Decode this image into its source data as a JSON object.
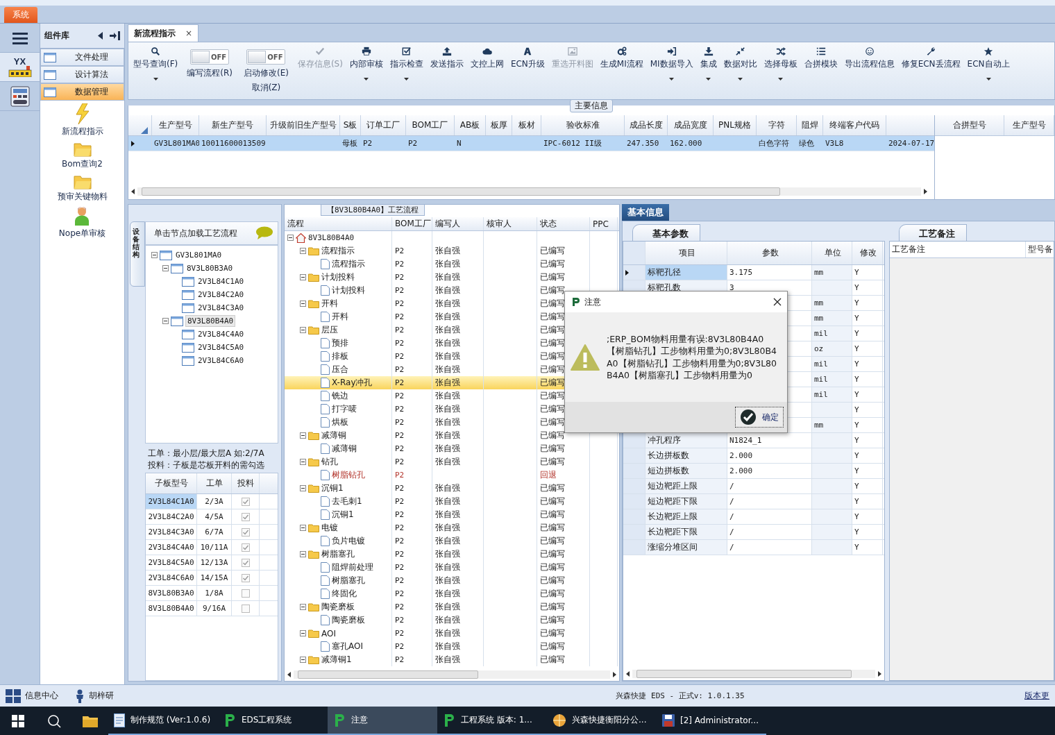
{
  "nav": {
    "logo_text": "YX"
  },
  "app_tab": {
    "label": "系统"
  },
  "component_library": {
    "title": "组件库",
    "items": [
      {
        "label": "文件处理",
        "selected": false
      },
      {
        "label": "设计算法",
        "selected": false
      },
      {
        "label": "数据管理",
        "selected": true
      }
    ],
    "tools": [
      {
        "label": "新流程指示",
        "kind": "lightning"
      },
      {
        "label": "Bom查询2",
        "kind": "folder"
      },
      {
        "label": "预审关键物料",
        "kind": "folder"
      },
      {
        "label": "Nope单审核",
        "kind": "person"
      }
    ]
  },
  "doc_tab": {
    "label": "新流程指示",
    "close": "×"
  },
  "toolbar": [
    {
      "kind": "search",
      "label": "型号查询(F)",
      "disabled": false,
      "dropdown": true
    },
    {
      "kind": "toggle",
      "label": "编写流程(R)",
      "text": "OFF",
      "on": false
    },
    {
      "kind": "toggle",
      "label": "启动修改(E)",
      "sublabel": "取消(Z)",
      "text": "OFF",
      "on": false
    },
    {
      "kind": "check",
      "label": "保存信息(S)",
      "disabled": true,
      "dropdown": false
    },
    {
      "kind": "printer",
      "label": "内部审核",
      "disabled": false,
      "dropdown": true
    },
    {
      "kind": "checkbox",
      "label": "指示检查",
      "disabled": false,
      "dropdown": true
    },
    {
      "kind": "upload",
      "label": "发送指示",
      "disabled": false,
      "dropdown": false
    },
    {
      "kind": "cloud",
      "label": "文控上网",
      "disabled": false,
      "dropdown": false
    },
    {
      "kind": "font",
      "label": "ECN升级",
      "disabled": false,
      "dropdown": false
    },
    {
      "kind": "image",
      "label": "重选开料图",
      "disabled": true,
      "dropdown": false
    },
    {
      "kind": "gears",
      "label": "生成MI流程",
      "disabled": false,
      "dropdown": false
    },
    {
      "kind": "sign-in",
      "label": "MI数据导入",
      "disabled": false,
      "dropdown": true
    },
    {
      "kind": "download",
      "label": "集成",
      "disabled": false,
      "dropdown": true
    },
    {
      "kind": "compress",
      "label": "数据对比",
      "disabled": false,
      "dropdown": true
    },
    {
      "kind": "shuffle",
      "label": "选择母板",
      "disabled": false,
      "dropdown": true
    },
    {
      "kind": "list",
      "label": "合拼模块",
      "disabled": false,
      "dropdown": false
    },
    {
      "kind": "smiley",
      "label": "导出流程信息",
      "disabled": false,
      "dropdown": false
    },
    {
      "kind": "wrench",
      "label": "修复ECN丢流程",
      "disabled": false,
      "dropdown": false
    },
    {
      "kind": "star",
      "label": "ECN自动上",
      "disabled": false,
      "dropdown": true
    }
  ],
  "main_info": {
    "title": "主要信息",
    "columns": [
      "生产型号",
      "新生产型号",
      "升级前旧生产型号",
      "S板",
      "订单工厂",
      "BOM工厂",
      "AB板",
      "板厚",
      "板材",
      "验收标准",
      "成品长度",
      "成品宽度",
      "PNL规格",
      "字符",
      "阻焊",
      "终端客户代码"
    ],
    "rows": [
      {
        "selected": true,
        "cells": [
          "GV3L801MA0",
          "10011600013509",
          null,
          "母板",
          "P2",
          "P2",
          "N",
          null,
          null,
          "IPC-6012 II级",
          "247.350",
          "162.000",
          null,
          "白色字符",
          "绿色",
          "V3L8",
          "2024-07-17"
        ]
      }
    ],
    "side_columns": [
      "合拼型号",
      "生产型号"
    ]
  },
  "structure_panel": {
    "side_tab": "设备结构",
    "title": "单击节点加载工艺流程",
    "tree": [
      {
        "label": "GV3L801MA0",
        "selected": false,
        "expanded": true,
        "children": [
          {
            "label": "8V3L80B3A0",
            "selected": false,
            "expanded": true,
            "children": [
              {
                "label": "2V3L84C1A0",
                "selected": false
              },
              {
                "label": "2V3L84C2A0",
                "selected": false
              },
              {
                "label": "2V3L84C3A0",
                "selected": false
              }
            ]
          },
          {
            "label": "8V3L80B4A0",
            "selected": true,
            "expanded": true,
            "children": [
              {
                "label": "2V3L84C4A0",
                "selected": false
              },
              {
                "label": "2V3L84C5A0",
                "selected": false
              },
              {
                "label": "2V3L84C6A0",
                "selected": false
              }
            ]
          }
        ]
      }
    ],
    "notes": [
      "工单：最小层/最大层A 如:2/7A",
      "投料：子板是芯板开料的需勾选"
    ],
    "board_table": {
      "columns": [
        "子板型号",
        "工单",
        "投料"
      ],
      "rows": [
        {
          "model": "2V3L84C1A0",
          "order": "2/3A",
          "checked": true,
          "selected": true
        },
        {
          "model": "2V3L84C2A0",
          "order": "4/5A",
          "checked": true,
          "selected": false
        },
        {
          "model": "2V3L84C3A0",
          "order": "6/7A",
          "checked": true,
          "selected": false
        },
        {
          "model": "2V3L84C4A0",
          "order": "10/11A",
          "checked": true,
          "selected": false
        },
        {
          "model": "2V3L84C5A0",
          "order": "12/13A",
          "checked": true,
          "selected": false
        },
        {
          "model": "2V3L84C6A0",
          "order": "14/15A",
          "checked": true,
          "selected": false
        },
        {
          "model": "8V3L80B3A0",
          "order": "1/8A",
          "checked": false,
          "selected": false
        },
        {
          "model": "8V3L80B4A0",
          "order": "9/16A",
          "checked": false,
          "selected": false
        }
      ]
    }
  },
  "process": {
    "title": "【8V3L80B4A0】工艺流程",
    "columns": [
      "流程",
      "BOM工厂",
      "编写人",
      "核审人",
      "状态",
      "PPC"
    ],
    "tree": [
      {
        "kind": "root",
        "label": "8V3L80B4A0",
        "selected": false,
        "expanded": true,
        "children": [
          {
            "kind": "group",
            "label": "流程指示",
            "factory": "P2",
            "writer": "张自强",
            "status": "已编写",
            "selected": false,
            "expanded": true,
            "children": [
              {
                "kind": "step",
                "label": "流程指示",
                "factory": "P2",
                "writer": "张自强",
                "status": "已编写",
                "selected": false
              }
            ]
          },
          {
            "kind": "group",
            "label": "计划投料",
            "factory": "P2",
            "writer": "张自强",
            "status": "已编写",
            "selected": false,
            "expanded": true,
            "children": [
              {
                "kind": "step",
                "label": "计划投料",
                "factory": "P2",
                "writer": "张自强",
                "status": "已编写",
                "selected": false
              }
            ]
          },
          {
            "kind": "group",
            "label": "开料",
            "factory": "P2",
            "writer": "张自强",
            "status": "已编写",
            "selected": false,
            "expanded": true,
            "children": [
              {
                "kind": "step",
                "label": "开料",
                "factory": "P2",
                "writer": "张自强",
                "status": "已编写",
                "selected": false
              }
            ]
          },
          {
            "kind": "group",
            "label": "层压",
            "factory": "P2",
            "writer": "张自强",
            "status": "已编写",
            "selected": false,
            "expanded": true,
            "children": [
              {
                "kind": "step",
                "label": "预排",
                "factory": "P2",
                "writer": "张自强",
                "status": "已编写",
                "selected": false
              },
              {
                "kind": "step",
                "label": "排板",
                "factory": "P2",
                "writer": "张自强",
                "status": "已编写",
                "selected": false
              },
              {
                "kind": "step",
                "label": "压合",
                "factory": "P2",
                "writer": "张自强",
                "status": "已编写",
                "selected": false
              },
              {
                "kind": "step",
                "label": "X-Ray冲孔",
                "factory": "P2",
                "writer": "张自强",
                "status": "已编写",
                "selected": true
              },
              {
                "kind": "step",
                "label": "铣边",
                "factory": "P2",
                "writer": "张自强",
                "status": "已编写",
                "selected": false
              },
              {
                "kind": "step",
                "label": "打字唛",
                "factory": "P2",
                "writer": "张自强",
                "status": "已编写",
                "selected": false
              },
              {
                "kind": "step",
                "label": "烘板",
                "factory": "P2",
                "writer": "张自强",
                "status": "已编写",
                "selected": false
              }
            ]
          },
          {
            "kind": "group",
            "label": "减薄铜",
            "factory": "P2",
            "writer": "张自强",
            "status": "已编写",
            "selected": false,
            "expanded": true,
            "children": [
              {
                "kind": "step",
                "label": "减薄铜",
                "factory": "P2",
                "writer": "张自强",
                "status": "已编写",
                "selected": false
              }
            ]
          },
          {
            "kind": "group",
            "label": "钻孔",
            "factory": "P2",
            "writer": "张自强",
            "status": "已编写",
            "selected": false,
            "expanded": true,
            "children": [
              {
                "kind": "returned",
                "label": "树脂钻孔",
                "factory": "P2",
                "status": "回退",
                "selected": false
              }
            ]
          },
          {
            "kind": "group",
            "label": "沉铜1",
            "factory": "P2",
            "writer": "张自强",
            "status": "已编写",
            "selected": false,
            "expanded": true,
            "children": [
              {
                "kind": "step",
                "label": "去毛刺1",
                "factory": "P2",
                "writer": "张自强",
                "status": "已编写",
                "selected": false
              },
              {
                "kind": "step",
                "label": "沉铜1",
                "factory": "P2",
                "writer": "张自强",
                "status": "已编写",
                "selected": false
              }
            ]
          },
          {
            "kind": "group",
            "label": "电镀",
            "factory": "P2",
            "writer": "张自强",
            "status": "已编写",
            "selected": false,
            "expanded": true,
            "children": [
              {
                "kind": "step",
                "label": "负片电镀",
                "factory": "P2",
                "writer": "张自强",
                "status": "已编写",
                "selected": false
              }
            ]
          },
          {
            "kind": "group",
            "label": "树脂塞孔",
            "factory": "P2",
            "writer": "张自强",
            "status": "已编写",
            "selected": false,
            "expanded": true,
            "children": [
              {
                "kind": "step",
                "label": "阻焊前处理",
                "factory": "P2",
                "writer": "张自强",
                "status": "已编写",
                "selected": false
              },
              {
                "kind": "step",
                "label": "树脂塞孔",
                "factory": "P2",
                "writer": "张自强",
                "status": "已编写",
                "selected": false
              },
              {
                "kind": "step",
                "label": "终固化",
                "factory": "P2",
                "writer": "张自强",
                "status": "已编写",
                "selected": false
              }
            ]
          },
          {
            "kind": "group",
            "label": "陶瓷磨板",
            "factory": "P2",
            "writer": "张自强",
            "status": "已编写",
            "selected": false,
            "expanded": true,
            "children": [
              {
                "kind": "step",
                "label": "陶瓷磨板",
                "factory": "P2",
                "writer": "张自强",
                "status": "已编写",
                "selected": false
              }
            ]
          },
          {
            "kind": "group",
            "label": "AOI",
            "factory": "P2",
            "writer": "张自强",
            "status": "已编写",
            "selected": false,
            "expanded": true,
            "children": [
              {
                "kind": "step",
                "label": "塞孔AOI",
                "factory": "P2",
                "writer": "张自强",
                "status": "已编写",
                "selected": false
              }
            ]
          },
          {
            "kind": "group",
            "label": "减薄铜1",
            "factory": "P2",
            "writer": "张自强",
            "status": "已编写",
            "selected": false,
            "expanded": true
          }
        ]
      }
    ]
  },
  "basic_info": {
    "tab": "基本信息",
    "params_tab": "基本参数",
    "columns": [
      "项目",
      "参数",
      "单位",
      "修改"
    ],
    "rows": [
      {
        "item": "标靶孔径",
        "param": "3.175",
        "unit": "mm",
        "modified": "Y",
        "selected": true
      },
      {
        "item": "标靶孔数",
        "param": "3",
        "modified": "Y",
        "selected": false
      },
      {
        "unit": "mm",
        "modified": "Y"
      },
      {
        "unit": "mm",
        "modified": "Y"
      },
      {
        "unit": "mil",
        "modified": "Y"
      },
      {
        "unit": "oz",
        "modified": "Y"
      },
      {
        "unit": "mil",
        "modified": "Y"
      },
      {
        "unit": "mil",
        "modified": "Y"
      },
      {
        "unit": "mil",
        "modified": "Y"
      },
      {
        "modified": "Y"
      },
      {
        "unit": "mm",
        "modified": "Y"
      },
      {
        "item": "冲孔程序",
        "param": "N1824_1",
        "modified": "Y",
        "selected": false
      },
      {
        "item": "长边拼板数",
        "param": "2.000",
        "modified": "Y",
        "selected": false
      },
      {
        "item": "短边拼板数",
        "param": "2.000",
        "modified": "Y",
        "selected": false
      },
      {
        "item": "短边靶距上限",
        "param": "/",
        "modified": "Y",
        "selected": false
      },
      {
        "item": "短边靶距下限",
        "param": "/",
        "modified": "Y",
        "selected": false
      },
      {
        "item": "长边靶距上限",
        "param": "/",
        "modified": "Y",
        "selected": false
      },
      {
        "item": "长边靶距下限",
        "param": "/",
        "modified": "Y",
        "selected": false
      },
      {
        "item": "涨缩分堆区间",
        "param": "/",
        "modified": "Y",
        "selected": false
      }
    ],
    "remarks_tab": "工艺备注",
    "remark_columns": [
      "工艺备注",
      "型号备"
    ]
  },
  "dialog": {
    "title": "注意",
    "message": ";ERP_BOM物料用量有误:8V3L80B4A0【树脂钻孔】工步物料用量为0;8V3L80B4A0【树脂钻孔】工步物料用量为0;8V3L80B4A0【树脂塞孔】工步物料用量为0",
    "ok": "确定"
  },
  "status_bar": {
    "info": "信息中心",
    "user": "胡梓研",
    "version": "兴森快捷 EDS - 正式v: 1.0.1.35",
    "link": "版本更"
  },
  "taskbar": [
    {
      "label": "制作规范 (Ver:1.0.6)",
      "kind": "document",
      "selected": false
    },
    {
      "label": "EDS工程系统",
      "kind": "app",
      "selected": false
    },
    {
      "label": "注意",
      "kind": "app",
      "selected": true
    },
    {
      "label": "工程系统  版本: 1...",
      "kind": "app",
      "selected": false
    },
    {
      "label": "兴森快捷衡阳分公...",
      "kind": "globe",
      "selected": false
    },
    {
      "label": "[2] Administrator...",
      "kind": "disk",
      "selected": false
    }
  ]
}
